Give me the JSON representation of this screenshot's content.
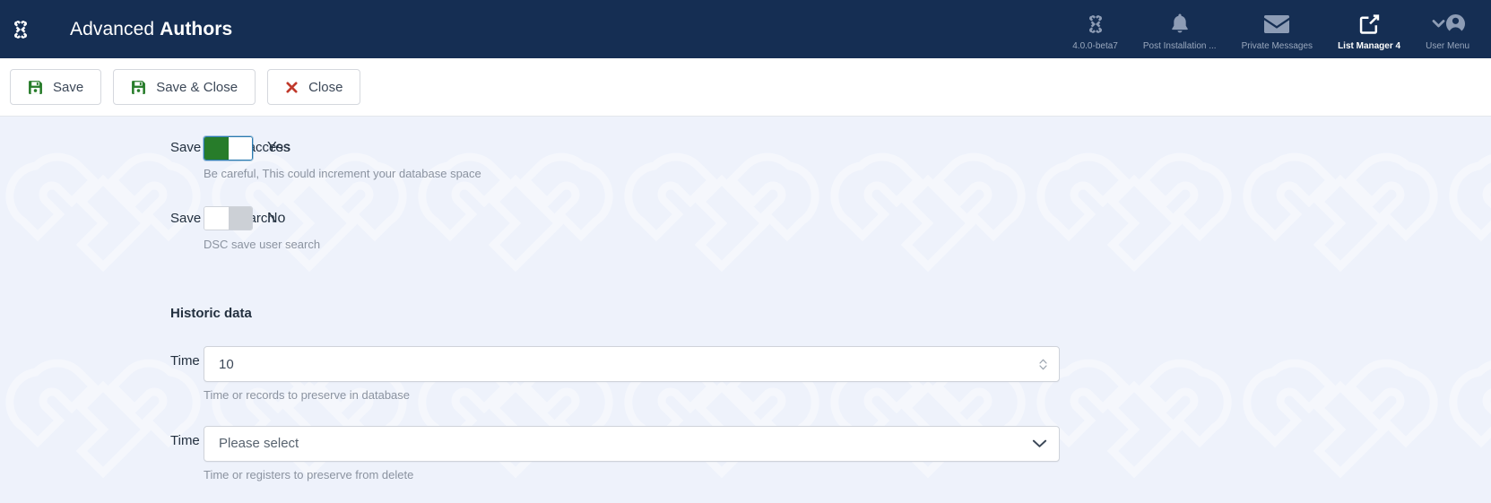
{
  "header": {
    "logo_icon": "joomla-logo-icon",
    "title_light": "Advanced ",
    "title_bold": "Authors",
    "tools": [
      {
        "icon": "joomla-version-icon",
        "label": "4.0.0-beta7",
        "active": false
      },
      {
        "icon": "bell-icon",
        "label": "Post Installation ...",
        "active": false
      },
      {
        "icon": "envelope-icon",
        "label": "Private Messages",
        "active": false
      },
      {
        "icon": "external-link-icon",
        "label": "List Manager 4",
        "active": true
      },
      {
        "icon": "user-avatar-icon",
        "label": "User Menu",
        "active": false
      }
    ]
  },
  "toolbar": {
    "buttons": [
      {
        "label": "Save",
        "icon": "save-disk-icon"
      },
      {
        "label": "Save & Close",
        "icon": "save-disk-icon"
      },
      {
        "label": "Close",
        "icon": "close-x-icon"
      }
    ]
  },
  "form": {
    "fields": [
      {
        "label": "Save history access",
        "type": "switch",
        "state": "on",
        "state_text": "Yes",
        "help": "Be careful, This could increment your database space"
      },
      {
        "label": "Save user search",
        "type": "switch",
        "state": "off",
        "state_text": "No",
        "help": "DSC save user search"
      }
    ],
    "section_title": "Historic data",
    "historic_fields": [
      {
        "label": "Time or records to preserve",
        "type": "number",
        "value": "10",
        "help": "Time or records to preserve in database"
      },
      {
        "label": "Time or Registers type",
        "type": "select",
        "value": "Please select",
        "help": "Time or registers to preserve from delete"
      }
    ]
  },
  "colors": {
    "header_bg": "#152e53",
    "page_bg": "#eef2fb",
    "accent_green": "#277c2a",
    "accent_red": "#c0392b",
    "focus_blue": "#2a7ab0"
  }
}
